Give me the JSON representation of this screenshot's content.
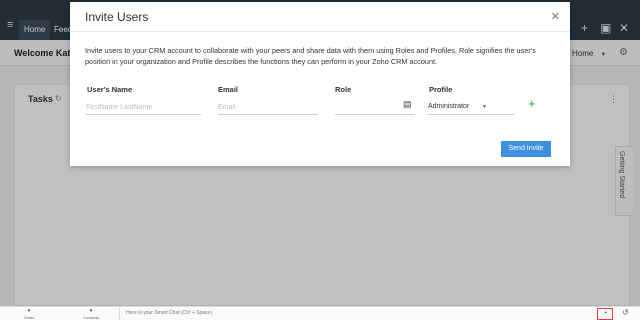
{
  "topbar": {
    "tabs": [
      {
        "label": "Home"
      },
      {
        "label": "Feeds"
      }
    ],
    "icons": [
      "menu-icon",
      "add-icon",
      "calendar-icon",
      "tools-icon"
    ]
  },
  "subbar": {
    "welcome": "Welcome Kath",
    "home_select": "Home"
  },
  "panel": {
    "title": "Tasks"
  },
  "getting_started": "Getting Started",
  "bottombar": {
    "items": [
      {
        "label": "Chats"
      },
      {
        "label": "Contacts"
      }
    ],
    "smart_chat_placeholder": "Here is your Smart Chat (Ctrl + Space)"
  },
  "modal": {
    "title": "Invite Users",
    "description": "Invite users to your CRM account to collaborate with your peers and share data with them using Roles and Profiles. Role signifies the user's position in your organization and Profile describes the functions they can perform in your Zoho CRM account.",
    "columns": {
      "name": "User's Name",
      "email": "Email",
      "role": "Role",
      "profile": "Profile"
    },
    "fields": {
      "name_placeholder": "FirstName LastName",
      "email_placeholder": "Email",
      "role_value": "",
      "profile_value": "Administrator"
    },
    "send_button": "Send Invite"
  },
  "colors": {
    "topbar": "#2e3a46",
    "primary_button": "#3d8fe0",
    "add_icon": "#3aa83a",
    "highlight_border": "#e23b3b"
  }
}
